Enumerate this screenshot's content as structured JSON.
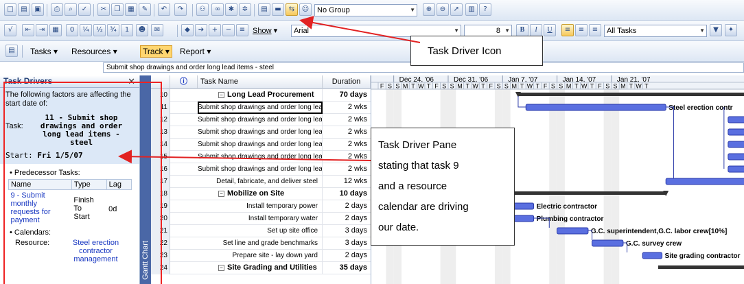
{
  "toolbar": {
    "group_combo": "No Group",
    "show_label": "Show",
    "font_combo": "Arial",
    "size_combo": "8",
    "bold": "B",
    "italic": "I",
    "underline": "U",
    "filter_combo": "All Tasks",
    "tasks_menu": "Tasks",
    "resources_menu": "Resources",
    "track_menu": "Track",
    "report_menu": "Report"
  },
  "entry_bar": "Submit shop drawings and order long lead items - steel",
  "task_drivers": {
    "title": "Task Drivers",
    "intro": "The following factors are affecting the start date of:",
    "task_label": "Task:",
    "task_line1": "11 - Submit shop",
    "task_line2": "drawings and order",
    "task_line3": "long lead items -",
    "task_line4": "steel",
    "start_label": "Start:",
    "start_value": "Fri 1/5/07",
    "predecessor_heading": "Predecessor Tasks:",
    "pred_headers": [
      "Name",
      "Type",
      "Lag"
    ],
    "pred_name_lines": [
      "9 - Submit",
      "monthly",
      "requests for",
      "payment"
    ],
    "pred_type_lines": [
      "Finish",
      "To",
      "Start"
    ],
    "pred_lag": "0d",
    "calendars_heading": "Calendars:",
    "resource_label": "Resource:",
    "resource_lines": [
      "Steel erection",
      "contractor",
      "management"
    ]
  },
  "view_bar_label": "Gantt Chart",
  "grid": {
    "col_name": "Task Name",
    "col_duration": "Duration",
    "rows": [
      {
        "id": "10",
        "name": "Long Lead Procurement",
        "duration": "70 days",
        "summary": true
      },
      {
        "id": "11",
        "name": "Submit shop drawings and order long lead items - steel",
        "duration": "2 wks",
        "summary": false
      },
      {
        "id": "12",
        "name": "Submit shop drawings and order long lead items - roofing",
        "duration": "2 wks",
        "summary": false
      },
      {
        "id": "13",
        "name": "Submit shop drawings and order long lead items - elevator",
        "duration": "2 wks",
        "summary": false
      },
      {
        "id": "14",
        "name": "Submit shop drawings and order long lead items - plumbing",
        "duration": "2 wks",
        "summary": false
      },
      {
        "id": "15",
        "name": "Submit shop drawings and order long lead items - electric",
        "duration": "2 wks",
        "summary": false
      },
      {
        "id": "16",
        "name": "Submit shop drawings and order long lead items - HVAC",
        "duration": "2 wks",
        "summary": false
      },
      {
        "id": "17",
        "name": "Detail, fabricate, and deliver steel",
        "duration": "12 wks",
        "summary": false
      },
      {
        "id": "18",
        "name": "Mobilize on Site",
        "duration": "10 days",
        "summary": true
      },
      {
        "id": "19",
        "name": "Install temporary power",
        "duration": "2 days",
        "summary": false
      },
      {
        "id": "20",
        "name": "Install temporary water",
        "duration": "2 days",
        "summary": false
      },
      {
        "id": "21",
        "name": "Set up site office",
        "duration": "3 days",
        "summary": false
      },
      {
        "id": "22",
        "name": "Set line and grade benchmarks",
        "duration": "3 days",
        "summary": false
      },
      {
        "id": "23",
        "name": "Prepare site - lay down yard",
        "duration": "2 days",
        "summary": false
      },
      {
        "id": "24",
        "name": "Site Grading and Utilities",
        "duration": "35 days",
        "summary": true
      }
    ]
  },
  "gantt": {
    "weeks": [
      "Dec 24, '06",
      "Dec 31, '06",
      "Jan 7, '07",
      "Jan 14, '07",
      "Jan 21, '07"
    ],
    "days": [
      "F",
      "S",
      "S",
      "M",
      "T",
      "W",
      "T",
      "F",
      "S",
      "S",
      "M",
      "T",
      "W",
      "T",
      "F",
      "S",
      "S",
      "M",
      "T",
      "W",
      "T",
      "F",
      "S",
      "S",
      "M",
      "T",
      "W",
      "T",
      "F",
      "S",
      "S",
      "M",
      "T",
      "W",
      "T"
    ],
    "labels": {
      "steel": "Steel erection contr",
      "electric": "Electric contractor",
      "plumbing": "Plumbing contractor",
      "gc": "G.C. superintendent,G.C. labor crew[10%]",
      "survey": "G.C. survey crew",
      "grading": "Site grading contractor"
    }
  },
  "callouts": {
    "icon": "Task Driver Icon",
    "pane_lines": [
      "Task Driver Pane",
      "stating that task 9",
      "and a resource",
      "calendar are driving",
      "our date."
    ]
  },
  "colors": {
    "bar": "#5a6fe0",
    "bar_dark": "#2a3aa8",
    "summary": "#333333",
    "annotation": "#e22222"
  }
}
